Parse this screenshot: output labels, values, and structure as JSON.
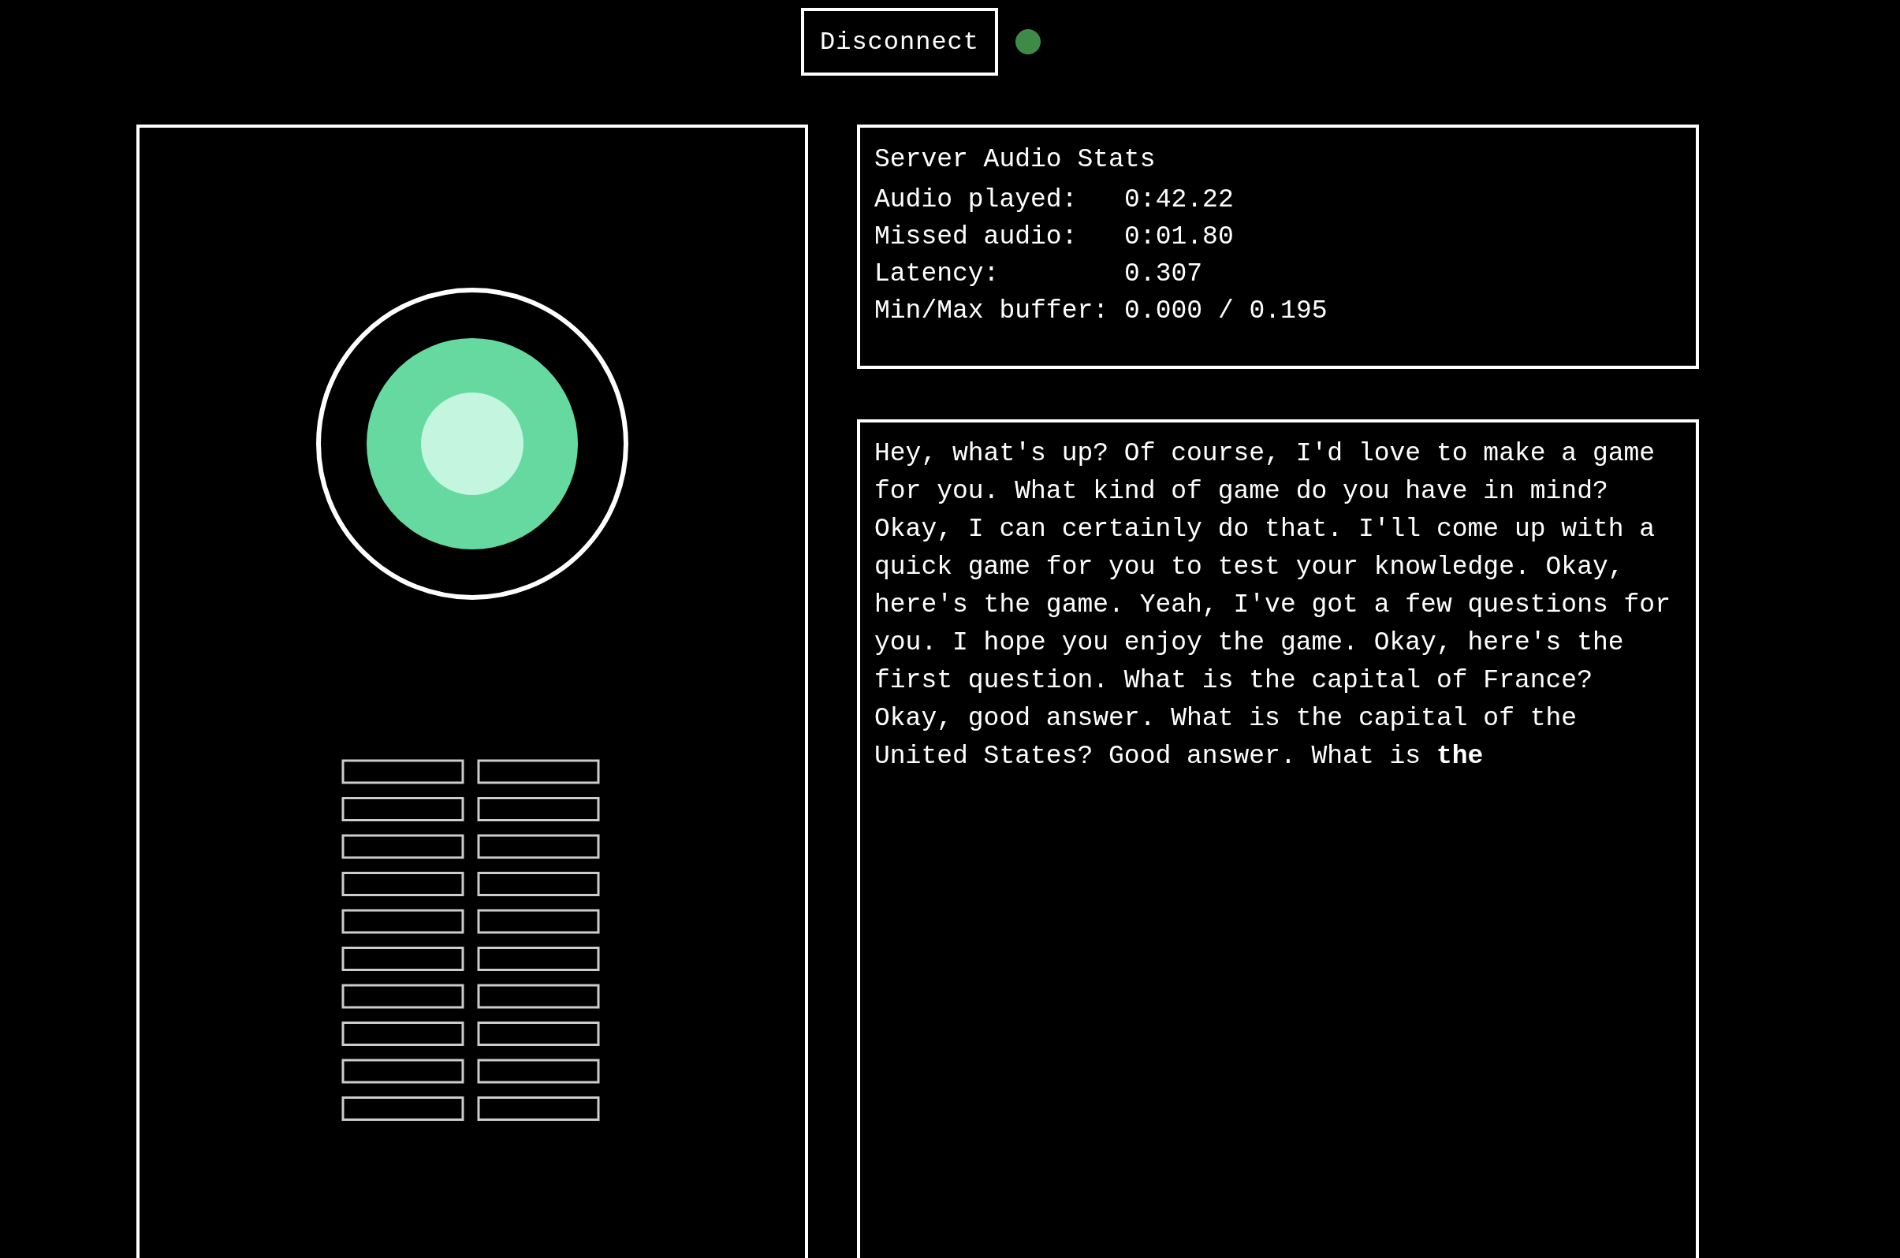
{
  "header": {
    "button": "Disconnect",
    "connected": true
  },
  "stats": {
    "title": "Server Audio Stats",
    "rows": [
      {
        "label": "Audio played:",
        "value": "0:42.22"
      },
      {
        "label": "Missed audio:",
        "value": "0:01.80"
      },
      {
        "label": "Latency:",
        "value": "0.307"
      },
      {
        "label": "Min/Max buffer:",
        "value": "0.000 / 0.195"
      }
    ]
  },
  "transcript": "Hey, what's up? Of course, I'd love to make a game for you. What kind of game do you have in mind? Okay, I can certainly do that. I'll come up with a quick game for you to test your knowledge. Okay, here's the game. Yeah, I've got a few questions for you. I hope you enjoy the game. Okay, here's the first question. What is the capital of France? Okay, good answer. What is the capital of the United States? Good answer. What is **the**"
}
